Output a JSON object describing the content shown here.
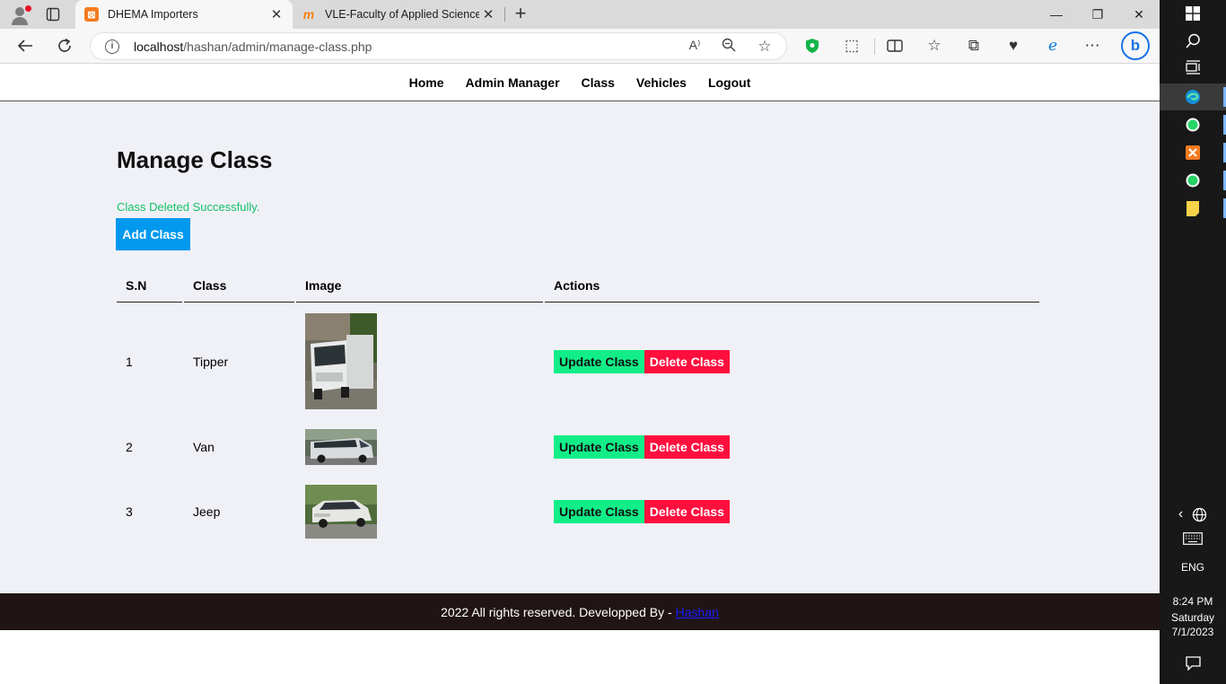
{
  "browser": {
    "tabs": [
      {
        "title": "DHEMA Importers",
        "favicon": "xampp-icon",
        "active": true
      },
      {
        "title": "VLE-Faculty of Applied Science: L",
        "favicon": "moodle-icon",
        "active": false
      }
    ],
    "url_host": "localhost",
    "url_path": "/hashan/admin/manage-class.php"
  },
  "nav": {
    "items": [
      "Home",
      "Admin Manager",
      "Class",
      "Vehicles",
      "Logout"
    ]
  },
  "page": {
    "title": "Manage Class",
    "flash": "Class Deleted Successfully.",
    "add_button": "Add Class"
  },
  "table": {
    "headers": [
      "S.N",
      "Class",
      "Image",
      "Actions"
    ],
    "rows": [
      {
        "sn": "1",
        "class": "Tipper",
        "image": "tipper-truck-photo",
        "update": "Update Class",
        "delete": "Delete Class"
      },
      {
        "sn": "2",
        "class": "Van",
        "image": "van-photo",
        "update": "Update Class",
        "delete": "Delete Class"
      },
      {
        "sn": "3",
        "class": "Jeep",
        "image": "jeep-photo",
        "update": "Update Class",
        "delete": "Delete Class"
      }
    ]
  },
  "footer": {
    "text": "2022 All rights reserved. Developped By -",
    "link": "Hashan"
  },
  "taskbar": {
    "language": "ENG",
    "time": "8:24 PM",
    "day": "Saturday",
    "date": "7/1/2023"
  },
  "colors": {
    "accent_blue": "#0099ee",
    "update_green": "#11ee88",
    "delete_red": "#ff0e3e",
    "success_text": "#16c06a",
    "page_bg": "#f0f1f6",
    "footer_bg": "#201514"
  }
}
